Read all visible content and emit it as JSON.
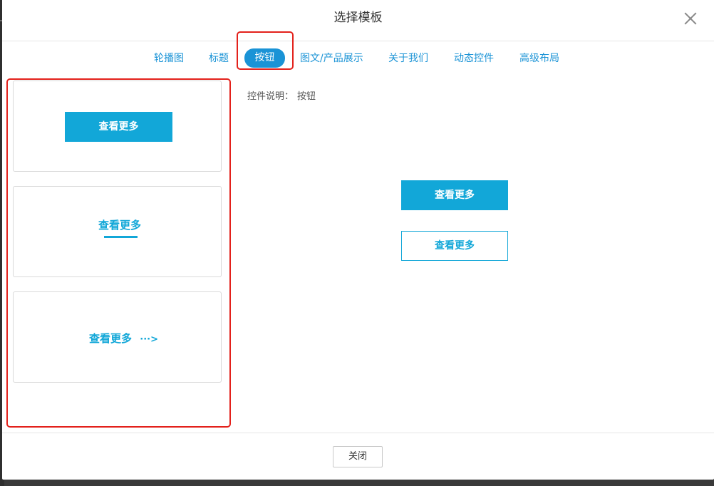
{
  "dialog": {
    "title": "选择模板",
    "close_button": "关闭"
  },
  "tabs": [
    {
      "label": "轮播图",
      "active": false
    },
    {
      "label": "标题",
      "active": false
    },
    {
      "label": "按钮",
      "active": true
    },
    {
      "label": "图文/产品展示",
      "active": false
    },
    {
      "label": "关于我们",
      "active": false
    },
    {
      "label": "动态控件",
      "active": false
    },
    {
      "label": "高级布局",
      "active": false
    }
  ],
  "templates": [
    {
      "style": "solid",
      "label": "查看更多"
    },
    {
      "style": "underline",
      "label": "查看更多"
    },
    {
      "style": "arrow",
      "label": "查看更多",
      "suffix": "···>"
    }
  ],
  "preview": {
    "description_label": "控件说明：",
    "description_value": "按钮",
    "primary_button": "查看更多",
    "secondary_button": "查看更多"
  },
  "colors": {
    "accent": "#12a7d8",
    "tab_active": "#1a93d6",
    "highlight": "#e3211b"
  }
}
